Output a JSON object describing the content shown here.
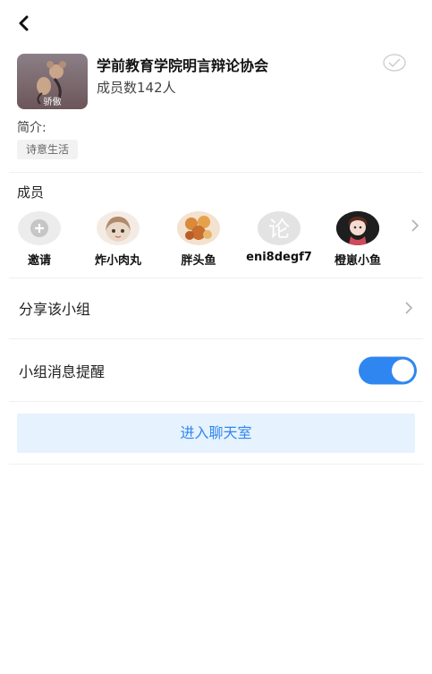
{
  "group": {
    "name": "学前教育学院明言辩论协会",
    "member_count": "成员数142人",
    "avatar_caption": "骄傲",
    "intro_label": "简介:",
    "tag": "诗意生活"
  },
  "members_section": {
    "title": "成员",
    "items": [
      {
        "name": "邀请"
      },
      {
        "name": "炸小肉丸"
      },
      {
        "name": "胖头鱼"
      },
      {
        "name": "eni8degf7"
      },
      {
        "name": "橙崽小鱼"
      }
    ]
  },
  "share": {
    "label": "分享该小组"
  },
  "notify": {
    "label": "小组消息提醒",
    "enabled": true
  },
  "chat_button": {
    "label": "进入聊天室"
  },
  "colors": {
    "accent": "#2f86f0",
    "button_bg": "#e6f2fd"
  }
}
